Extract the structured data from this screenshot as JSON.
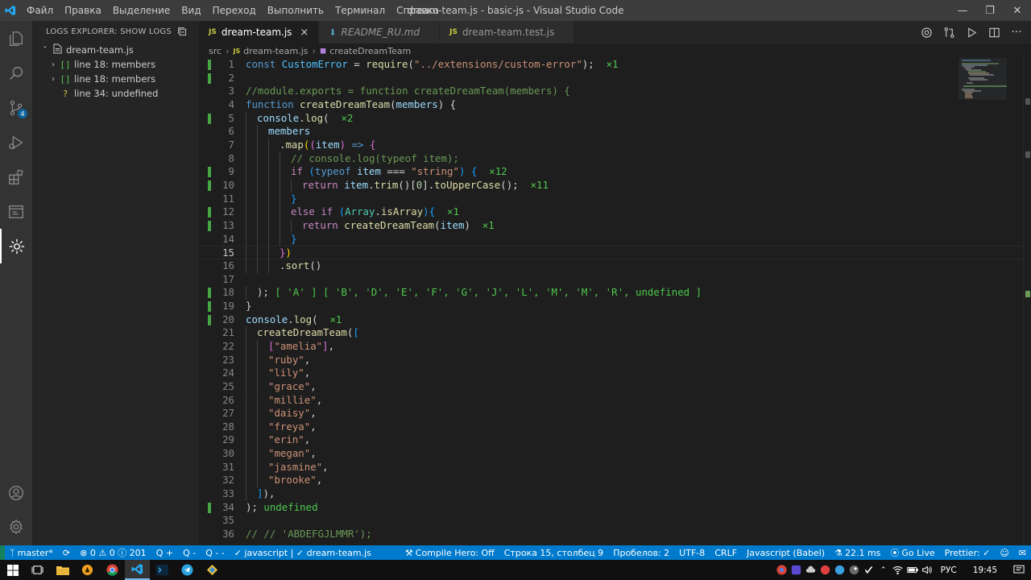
{
  "window": {
    "title": "dream-team.js - basic-js - Visual Studio Code",
    "menu": [
      "Файл",
      "Правка",
      "Выделение",
      "Вид",
      "Переход",
      "Выполнить",
      "Терминал",
      "Справка"
    ]
  },
  "activity_bar": {
    "icons": [
      "files-icon",
      "search-icon",
      "source-control-icon",
      "run-debug-icon",
      "extensions-icon",
      "remote-explorer-icon",
      "logs-explorer-icon"
    ],
    "source_control_badge": "4"
  },
  "sidebar": {
    "title": "LOGS EXPLORER: SHOW LOGS",
    "tree": [
      {
        "label": "dream-team.js",
        "icon": "file-icon",
        "level": 0,
        "chevron": "˅"
      },
      {
        "label": "line 18: members",
        "icon": "[]",
        "level": 1,
        "chevron": "›"
      },
      {
        "label": "line 18: members",
        "icon": "[]",
        "level": 1,
        "chevron": "›"
      },
      {
        "label": "line 34: undefined",
        "icon": "?",
        "level": 1,
        "chevron": ""
      }
    ]
  },
  "tabs": [
    {
      "label": "dream-team.js",
      "type": "js",
      "active": true
    },
    {
      "label": "README_RU.md",
      "type": "md",
      "active": false
    },
    {
      "label": "dream-team.test.js",
      "type": "js",
      "active": false
    }
  ],
  "breadcrumb": [
    "src",
    "dream-team.js",
    "createDreamTeam"
  ],
  "editor": {
    "current_line": 15,
    "lines": [
      {
        "n": 1,
        "indent": 0,
        "html": "<span class='kw'>const</span> <span class='con'>CustomError</span> = <span class='fn'>require</span>(<span class='str'>\"../extensions/custom-error\"</span>);  <span class='qk'>×1</span>",
        "gut": true
      },
      {
        "n": 2,
        "indent": 0,
        "html": "",
        "gut": true
      },
      {
        "n": 3,
        "indent": 0,
        "html": "<span class='cm'>//module.exports = function createDreamTeam(members) {</span>",
        "gut": false
      },
      {
        "n": 4,
        "indent": 0,
        "html": "<span class='kw'>function</span> <span class='fn'>createDreamTeam</span>(<span class='var'>members</span>) {",
        "gut": false
      },
      {
        "n": 5,
        "indent": 1,
        "html": "<span class='var'>console</span>.<span class='fn'>log</span>(  <span class='qk'>×2</span>",
        "gut": true
      },
      {
        "n": 6,
        "indent": 2,
        "html": "<span class='var'>members</span>",
        "gut": false
      },
      {
        "n": 7,
        "indent": 3,
        "html": ".<span class='fn'>map</span><span class='br1'>(</span><span class='br2'>(</span><span class='var'>item</span><span class='br2'>)</span> <span class='kw'>=&gt;</span> <span class='br2'>{</span>",
        "gut": false
      },
      {
        "n": 8,
        "indent": 4,
        "html": "<span class='cm'>// console.log(typeof item);</span>",
        "gut": false
      },
      {
        "n": 9,
        "indent": 4,
        "html": "<span class='kw2'>if</span> <span class='br3'>(</span><span class='kw'>typeof</span> <span class='var'>item</span> === <span class='str'>\"string\"</span><span class='br3'>)</span> <span class='br3'>{</span>  <span class='qk'>×12</span>",
        "gut": true
      },
      {
        "n": 10,
        "indent": 5,
        "html": "<span class='kw2'>return</span> <span class='var'>item</span>.<span class='fn'>trim</span>()[<span class='num'>0</span>].<span class='fn'>toUpperCase</span>();  <span class='qk'>×11</span>",
        "gut": true
      },
      {
        "n": 11,
        "indent": 4,
        "html": "<span class='br3'>}</span>",
        "gut": false
      },
      {
        "n": 12,
        "indent": 4,
        "html": "<span class='kw2'>else</span> <span class='kw2'>if</span> <span class='br3'>(</span><span class='cls'>Array</span>.<span class='fn'>isArray</span><span class='br3'>)</span><span class='br3'>{</span>  <span class='qk'>×1</span>",
        "gut": true
      },
      {
        "n": 13,
        "indent": 5,
        "html": "<span class='kw2'>return</span> <span class='fn'>createDreamTeam</span>(<span class='var'>item</span>)  <span class='qk'>×1</span>",
        "gut": true
      },
      {
        "n": 14,
        "indent": 4,
        "html": "<span class='br3'>}</span>",
        "gut": false
      },
      {
        "n": 15,
        "indent": 3,
        "html": "<span class='br2'>}</span><span class='br1'>)</span>",
        "gut": false
      },
      {
        "n": 16,
        "indent": 3,
        "html": ".<span class='fn'>sort</span>()",
        "gut": false
      },
      {
        "n": 17,
        "indent": 0,
        "html": "",
        "gut": false
      },
      {
        "n": 18,
        "indent": 1,
        "html": "); <span class='qk'>[ 'A' ] [ 'B', 'D', 'E', 'F', 'G', 'J', 'L', 'M', 'M', 'R', undefined ]</span>",
        "gut": true
      },
      {
        "n": 19,
        "indent": 0,
        "html": "}",
        "gut": true
      },
      {
        "n": 20,
        "indent": 0,
        "html": "<span class='var'>console</span>.<span class='fn'>log</span>(  <span class='qk'>×1</span>",
        "gut": true
      },
      {
        "n": 21,
        "indent": 1,
        "html": "<span class='fn'>createDreamTeam</span>(<span class='br3'>[</span>",
        "gut": false
      },
      {
        "n": 22,
        "indent": 2,
        "html": "<span class='br2'>[</span><span class='str'>\"amelia\"</span><span class='br2'>]</span>,",
        "gut": false
      },
      {
        "n": 23,
        "indent": 2,
        "html": "<span class='str'>\"ruby\"</span>,",
        "gut": false
      },
      {
        "n": 24,
        "indent": 2,
        "html": "<span class='str'>\"lily\"</span>,",
        "gut": false
      },
      {
        "n": 25,
        "indent": 2,
        "html": "<span class='str'>\"grace\"</span>,",
        "gut": false
      },
      {
        "n": 26,
        "indent": 2,
        "html": "<span class='str'>\"millie\"</span>,",
        "gut": false
      },
      {
        "n": 27,
        "indent": 2,
        "html": "<span class='str'>\"daisy\"</span>,",
        "gut": false
      },
      {
        "n": 28,
        "indent": 2,
        "html": "<span class='str'>\"freya\"</span>,",
        "gut": false
      },
      {
        "n": 29,
        "indent": 2,
        "html": "<span class='str'>\"erin\"</span>,",
        "gut": false
      },
      {
        "n": 30,
        "indent": 2,
        "html": "<span class='str'>\"megan\"</span>,",
        "gut": false
      },
      {
        "n": 31,
        "indent": 2,
        "html": "<span class='str'>\"jasmine\"</span>,",
        "gut": false
      },
      {
        "n": 32,
        "indent": 2,
        "html": "<span class='str'>\"brooke\"</span>,",
        "gut": false
      },
      {
        "n": 33,
        "indent": 1,
        "html": "<span class='br3'>]</span>),",
        "gut": false
      },
      {
        "n": 34,
        "indent": 0,
        "html": "); <span class='qk'>undefined</span>",
        "gut": true
      },
      {
        "n": 35,
        "indent": 0,
        "html": "",
        "gut": false
      },
      {
        "n": 36,
        "indent": 0,
        "html": "<span class='cm'>// // 'ABDEFGJLMMR');</span>",
        "gut": false
      }
    ]
  },
  "statusbar": {
    "left": [
      "master*",
      "⟳",
      "⊗ 0 ⚠ 0 ⓘ 201",
      "Q +",
      "Q -",
      "Q - -",
      "✓ javascript | ✓ dream-team.js"
    ],
    "right": [
      "Compile Hero: Off",
      "Строка 15, столбец 9",
      "Пробелов: 2",
      "UTF-8",
      "CRLF",
      "Javascript (Babel)",
      "22.1 ms",
      "Go Live",
      "Prettier: ✓"
    ]
  },
  "taskbar": {
    "lang": "РУС",
    "time": "19:45"
  },
  "colors": {
    "accent": "#007acc",
    "titlebar": "#3c3c3c",
    "editor_bg": "#1e1e1e"
  }
}
